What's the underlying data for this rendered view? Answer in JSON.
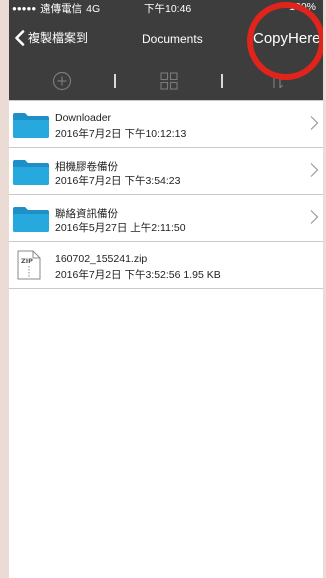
{
  "status_bar": {
    "signal": "●●●●●",
    "carrier": "遠傳電信",
    "network": "4G",
    "time": "下午10:46",
    "battery": "100%"
  },
  "nav": {
    "back_label": "複製檔案到",
    "title": "Documents",
    "action_label": "CopyHere"
  },
  "toolbar": {
    "icons": [
      "add-circle-icon",
      "grid-view-icon",
      "sort-icon"
    ]
  },
  "files": [
    {
      "name": "Downloader",
      "meta": "2016年7月2日 下午10:12:13",
      "type": "folder"
    },
    {
      "name": "相機膠卷備份",
      "meta": "2016年7月2日 下午3:54:23",
      "type": "folder"
    },
    {
      "name": "聯絡資訊備份",
      "meta": "2016年5月27日 上午2:11:50",
      "type": "folder"
    },
    {
      "name": "160702_155241.zip",
      "meta": "2016年7月2日 下午3:52:56  1.95 KB",
      "type": "zip"
    }
  ],
  "colors": {
    "bar": "#3d3d3d",
    "folder": "#27a9de",
    "highlight_circle": "#e0241b",
    "background": "#eadbd4"
  }
}
